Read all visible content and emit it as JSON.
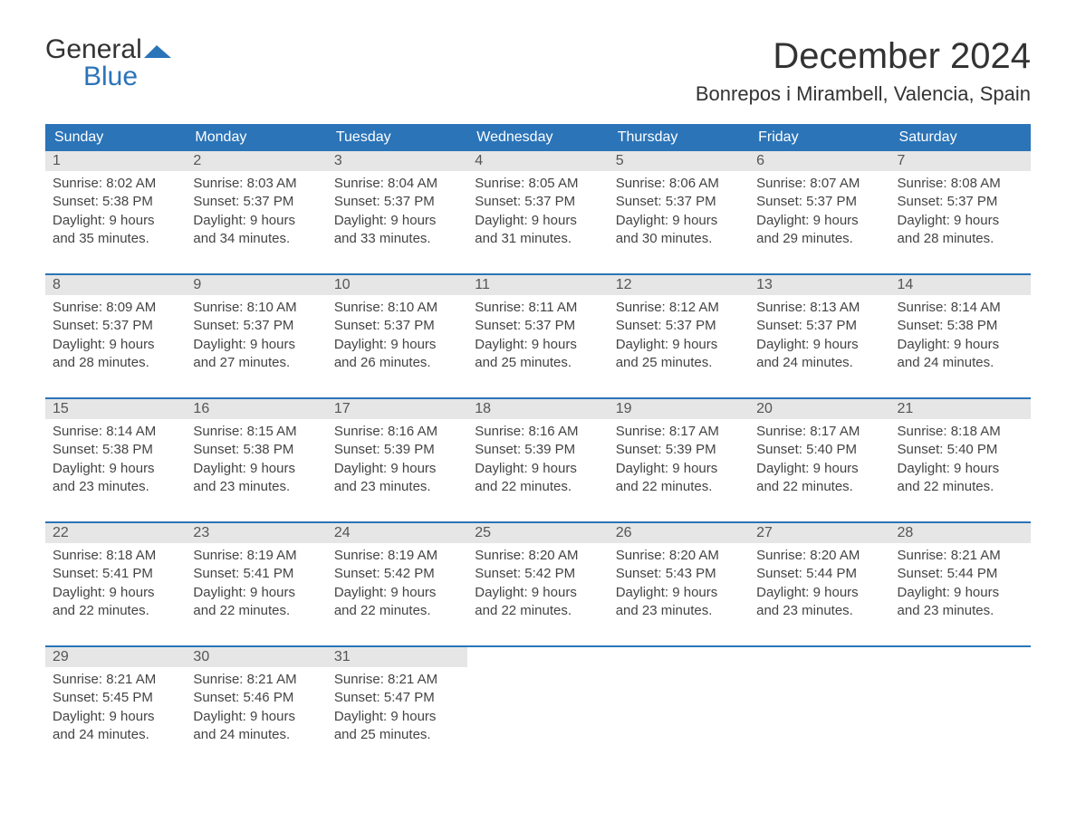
{
  "brand": {
    "part1": "General",
    "part2": "Blue"
  },
  "title": "December 2024",
  "location": "Bonrepos i Mirambell, Valencia, Spain",
  "dow": [
    "Sunday",
    "Monday",
    "Tuesday",
    "Wednesday",
    "Thursday",
    "Friday",
    "Saturday"
  ],
  "weeks": [
    [
      {
        "n": "1",
        "sr": "Sunrise: 8:02 AM",
        "ss": "Sunset: 5:38 PM",
        "d1": "Daylight: 9 hours",
        "d2": "and 35 minutes."
      },
      {
        "n": "2",
        "sr": "Sunrise: 8:03 AM",
        "ss": "Sunset: 5:37 PM",
        "d1": "Daylight: 9 hours",
        "d2": "and 34 minutes."
      },
      {
        "n": "3",
        "sr": "Sunrise: 8:04 AM",
        "ss": "Sunset: 5:37 PM",
        "d1": "Daylight: 9 hours",
        "d2": "and 33 minutes."
      },
      {
        "n": "4",
        "sr": "Sunrise: 8:05 AM",
        "ss": "Sunset: 5:37 PM",
        "d1": "Daylight: 9 hours",
        "d2": "and 31 minutes."
      },
      {
        "n": "5",
        "sr": "Sunrise: 8:06 AM",
        "ss": "Sunset: 5:37 PM",
        "d1": "Daylight: 9 hours",
        "d2": "and 30 minutes."
      },
      {
        "n": "6",
        "sr": "Sunrise: 8:07 AM",
        "ss": "Sunset: 5:37 PM",
        "d1": "Daylight: 9 hours",
        "d2": "and 29 minutes."
      },
      {
        "n": "7",
        "sr": "Sunrise: 8:08 AM",
        "ss": "Sunset: 5:37 PM",
        "d1": "Daylight: 9 hours",
        "d2": "and 28 minutes."
      }
    ],
    [
      {
        "n": "8",
        "sr": "Sunrise: 8:09 AM",
        "ss": "Sunset: 5:37 PM",
        "d1": "Daylight: 9 hours",
        "d2": "and 28 minutes."
      },
      {
        "n": "9",
        "sr": "Sunrise: 8:10 AM",
        "ss": "Sunset: 5:37 PM",
        "d1": "Daylight: 9 hours",
        "d2": "and 27 minutes."
      },
      {
        "n": "10",
        "sr": "Sunrise: 8:10 AM",
        "ss": "Sunset: 5:37 PM",
        "d1": "Daylight: 9 hours",
        "d2": "and 26 minutes."
      },
      {
        "n": "11",
        "sr": "Sunrise: 8:11 AM",
        "ss": "Sunset: 5:37 PM",
        "d1": "Daylight: 9 hours",
        "d2": "and 25 minutes."
      },
      {
        "n": "12",
        "sr": "Sunrise: 8:12 AM",
        "ss": "Sunset: 5:37 PM",
        "d1": "Daylight: 9 hours",
        "d2": "and 25 minutes."
      },
      {
        "n": "13",
        "sr": "Sunrise: 8:13 AM",
        "ss": "Sunset: 5:37 PM",
        "d1": "Daylight: 9 hours",
        "d2": "and 24 minutes."
      },
      {
        "n": "14",
        "sr": "Sunrise: 8:14 AM",
        "ss": "Sunset: 5:38 PM",
        "d1": "Daylight: 9 hours",
        "d2": "and 24 minutes."
      }
    ],
    [
      {
        "n": "15",
        "sr": "Sunrise: 8:14 AM",
        "ss": "Sunset: 5:38 PM",
        "d1": "Daylight: 9 hours",
        "d2": "and 23 minutes."
      },
      {
        "n": "16",
        "sr": "Sunrise: 8:15 AM",
        "ss": "Sunset: 5:38 PM",
        "d1": "Daylight: 9 hours",
        "d2": "and 23 minutes."
      },
      {
        "n": "17",
        "sr": "Sunrise: 8:16 AM",
        "ss": "Sunset: 5:39 PM",
        "d1": "Daylight: 9 hours",
        "d2": "and 23 minutes."
      },
      {
        "n": "18",
        "sr": "Sunrise: 8:16 AM",
        "ss": "Sunset: 5:39 PM",
        "d1": "Daylight: 9 hours",
        "d2": "and 22 minutes."
      },
      {
        "n": "19",
        "sr": "Sunrise: 8:17 AM",
        "ss": "Sunset: 5:39 PM",
        "d1": "Daylight: 9 hours",
        "d2": "and 22 minutes."
      },
      {
        "n": "20",
        "sr": "Sunrise: 8:17 AM",
        "ss": "Sunset: 5:40 PM",
        "d1": "Daylight: 9 hours",
        "d2": "and 22 minutes."
      },
      {
        "n": "21",
        "sr": "Sunrise: 8:18 AM",
        "ss": "Sunset: 5:40 PM",
        "d1": "Daylight: 9 hours",
        "d2": "and 22 minutes."
      }
    ],
    [
      {
        "n": "22",
        "sr": "Sunrise: 8:18 AM",
        "ss": "Sunset: 5:41 PM",
        "d1": "Daylight: 9 hours",
        "d2": "and 22 minutes."
      },
      {
        "n": "23",
        "sr": "Sunrise: 8:19 AM",
        "ss": "Sunset: 5:41 PM",
        "d1": "Daylight: 9 hours",
        "d2": "and 22 minutes."
      },
      {
        "n": "24",
        "sr": "Sunrise: 8:19 AM",
        "ss": "Sunset: 5:42 PM",
        "d1": "Daylight: 9 hours",
        "d2": "and 22 minutes."
      },
      {
        "n": "25",
        "sr": "Sunrise: 8:20 AM",
        "ss": "Sunset: 5:42 PM",
        "d1": "Daylight: 9 hours",
        "d2": "and 22 minutes."
      },
      {
        "n": "26",
        "sr": "Sunrise: 8:20 AM",
        "ss": "Sunset: 5:43 PM",
        "d1": "Daylight: 9 hours",
        "d2": "and 23 minutes."
      },
      {
        "n": "27",
        "sr": "Sunrise: 8:20 AM",
        "ss": "Sunset: 5:44 PM",
        "d1": "Daylight: 9 hours",
        "d2": "and 23 minutes."
      },
      {
        "n": "28",
        "sr": "Sunrise: 8:21 AM",
        "ss": "Sunset: 5:44 PM",
        "d1": "Daylight: 9 hours",
        "d2": "and 23 minutes."
      }
    ],
    [
      {
        "n": "29",
        "sr": "Sunrise: 8:21 AM",
        "ss": "Sunset: 5:45 PM",
        "d1": "Daylight: 9 hours",
        "d2": "and 24 minutes."
      },
      {
        "n": "30",
        "sr": "Sunrise: 8:21 AM",
        "ss": "Sunset: 5:46 PM",
        "d1": "Daylight: 9 hours",
        "d2": "and 24 minutes."
      },
      {
        "n": "31",
        "sr": "Sunrise: 8:21 AM",
        "ss": "Sunset: 5:47 PM",
        "d1": "Daylight: 9 hours",
        "d2": "and 25 minutes."
      },
      null,
      null,
      null,
      null
    ]
  ]
}
